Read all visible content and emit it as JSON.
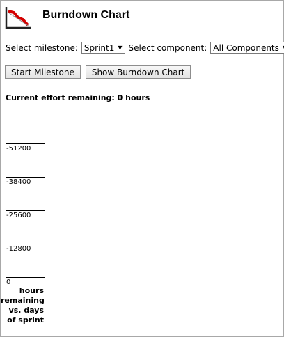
{
  "header": {
    "title": "Burndown Chart",
    "logo_icon": "burndown-chart-icon"
  },
  "controls": {
    "milestone_label": "Select milestone:",
    "milestone_value": "Sprint1",
    "component_label": "Select component:",
    "component_value": "All Components"
  },
  "buttons": {
    "start_milestone": "Start Milestone",
    "show_chart": "Show Burndown Chart"
  },
  "status": {
    "effort": "Current effort remaining: 0 hours"
  },
  "chart_data": {
    "type": "bar",
    "title": "",
    "xlabel": "",
    "ylabel": "",
    "caption_lines": [
      "hours",
      "remaining",
      "vs. days",
      "of sprint"
    ],
    "y_ticks": [
      "-51200",
      "-38400",
      "-25600",
      "-12800",
      "0"
    ],
    "categories": [],
    "values": []
  }
}
